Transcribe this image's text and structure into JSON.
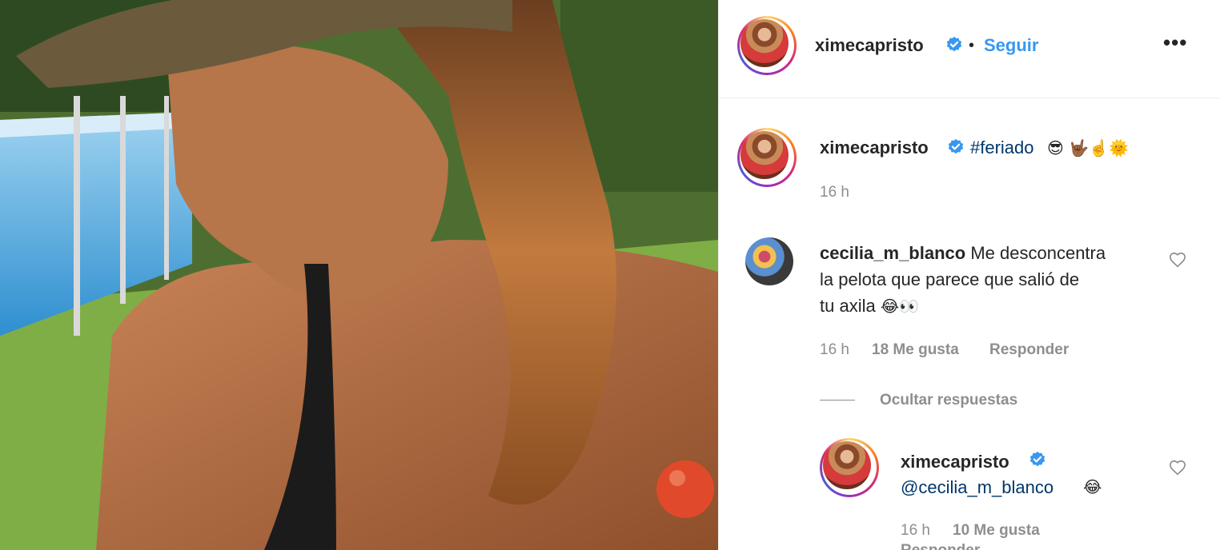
{
  "post": {
    "author": "ximecapristo",
    "separator": "•",
    "follow_label": "Seguir",
    "more_label": "•••"
  },
  "caption": {
    "author": "ximecapristo",
    "hashtag": "#feriado",
    "emojis": "😎 🤟🏾☝️🌞",
    "time": "16 h"
  },
  "comments": [
    {
      "author": "cecilia_m_blanco",
      "text_line1": "Me desconcentra",
      "text_line2": "la pelota que parece que salió de",
      "text_line3": "tu axila",
      "emojis": "😂👀",
      "time": "16 h",
      "likes": "18 Me gusta",
      "reply_label": "Responder",
      "hide_replies_label": "Ocultar respuestas"
    }
  ],
  "reply": {
    "author": "ximecapristo",
    "mention": "@cecilia_m_blanco",
    "emojis": "😂",
    "time": "16 h",
    "likes": "10 Me gusta",
    "reply_label": "Responder"
  },
  "colors": {
    "link": "#3897f0",
    "hashtag": "#00376b",
    "muted": "#8e8e8e",
    "verified": "#3897f0"
  },
  "icons": {
    "verified": "verified-badge-icon",
    "heart": "heart-outline-icon",
    "more": "more-horizontal-icon"
  }
}
